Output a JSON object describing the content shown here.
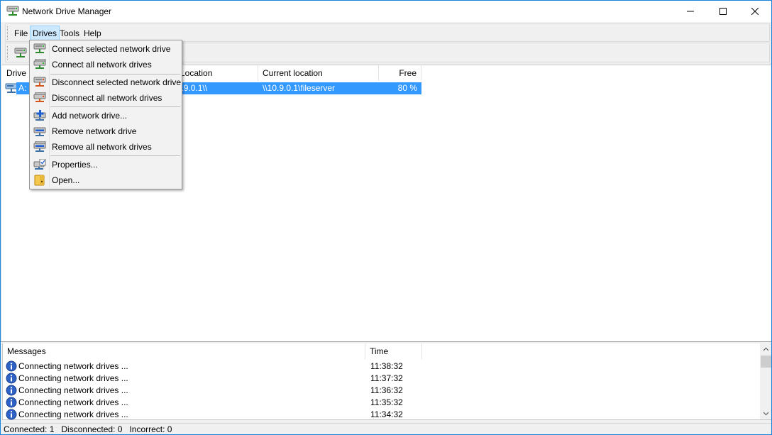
{
  "window": {
    "title": "Network Drive Manager",
    "colors": {
      "accent": "#1883d7",
      "selection": "#3399ff",
      "menu_hover": "#cce8ff"
    }
  },
  "menubar": {
    "items": [
      {
        "label": "File",
        "icon": ""
      },
      {
        "label": "Drives",
        "icon": ""
      },
      {
        "label": "Tools",
        "icon": ""
      },
      {
        "label": "Help",
        "icon": ""
      }
    ]
  },
  "drives_table": {
    "columns": [
      "Drive",
      "Location",
      "Current location",
      "Free"
    ],
    "rows": [
      {
        "drive": "A:",
        "location": "\\\\10.9.0.1\\fileserver",
        "current_location": "\\\\10.9.0.1\\fileserver",
        "free": "80 %"
      }
    ]
  },
  "drives_menu": {
    "items": [
      {
        "label": "Connect selected network drive",
        "icon": "connect-drive-icon"
      },
      {
        "label": "Connect all network drives",
        "icon": "connect-all-icon"
      },
      {
        "label": "Disconnect selected network drive",
        "icon": "disconnect-drive-icon"
      },
      {
        "label": "Disconnect all network drives",
        "icon": "disconnect-all-icon"
      },
      {
        "label": "Add network drive...",
        "icon": "add-drive-icon"
      },
      {
        "label": "Remove network drive",
        "icon": "remove-drive-icon"
      },
      {
        "label": "Remove all network drives",
        "icon": "remove-all-icon"
      },
      {
        "label": "Properties...",
        "icon": "properties-icon"
      },
      {
        "label": "Open...",
        "icon": "folder-icon"
      }
    ]
  },
  "messages": {
    "columns": [
      "Messages",
      "Time"
    ],
    "rows": [
      {
        "text": "Connecting network drives ...",
        "time": "11:38:32"
      },
      {
        "text": "Connecting network drives ...",
        "time": "11:37:32"
      },
      {
        "text": "Connecting network drives ...",
        "time": "11:36:32"
      },
      {
        "text": "Connecting network drives ...",
        "time": "11:35:32"
      },
      {
        "text": "Connecting network drives ...",
        "time": "11:34:32"
      }
    ]
  },
  "status": {
    "text": "Connected: 1   Disconnected: 0   Incorrect: 0"
  }
}
